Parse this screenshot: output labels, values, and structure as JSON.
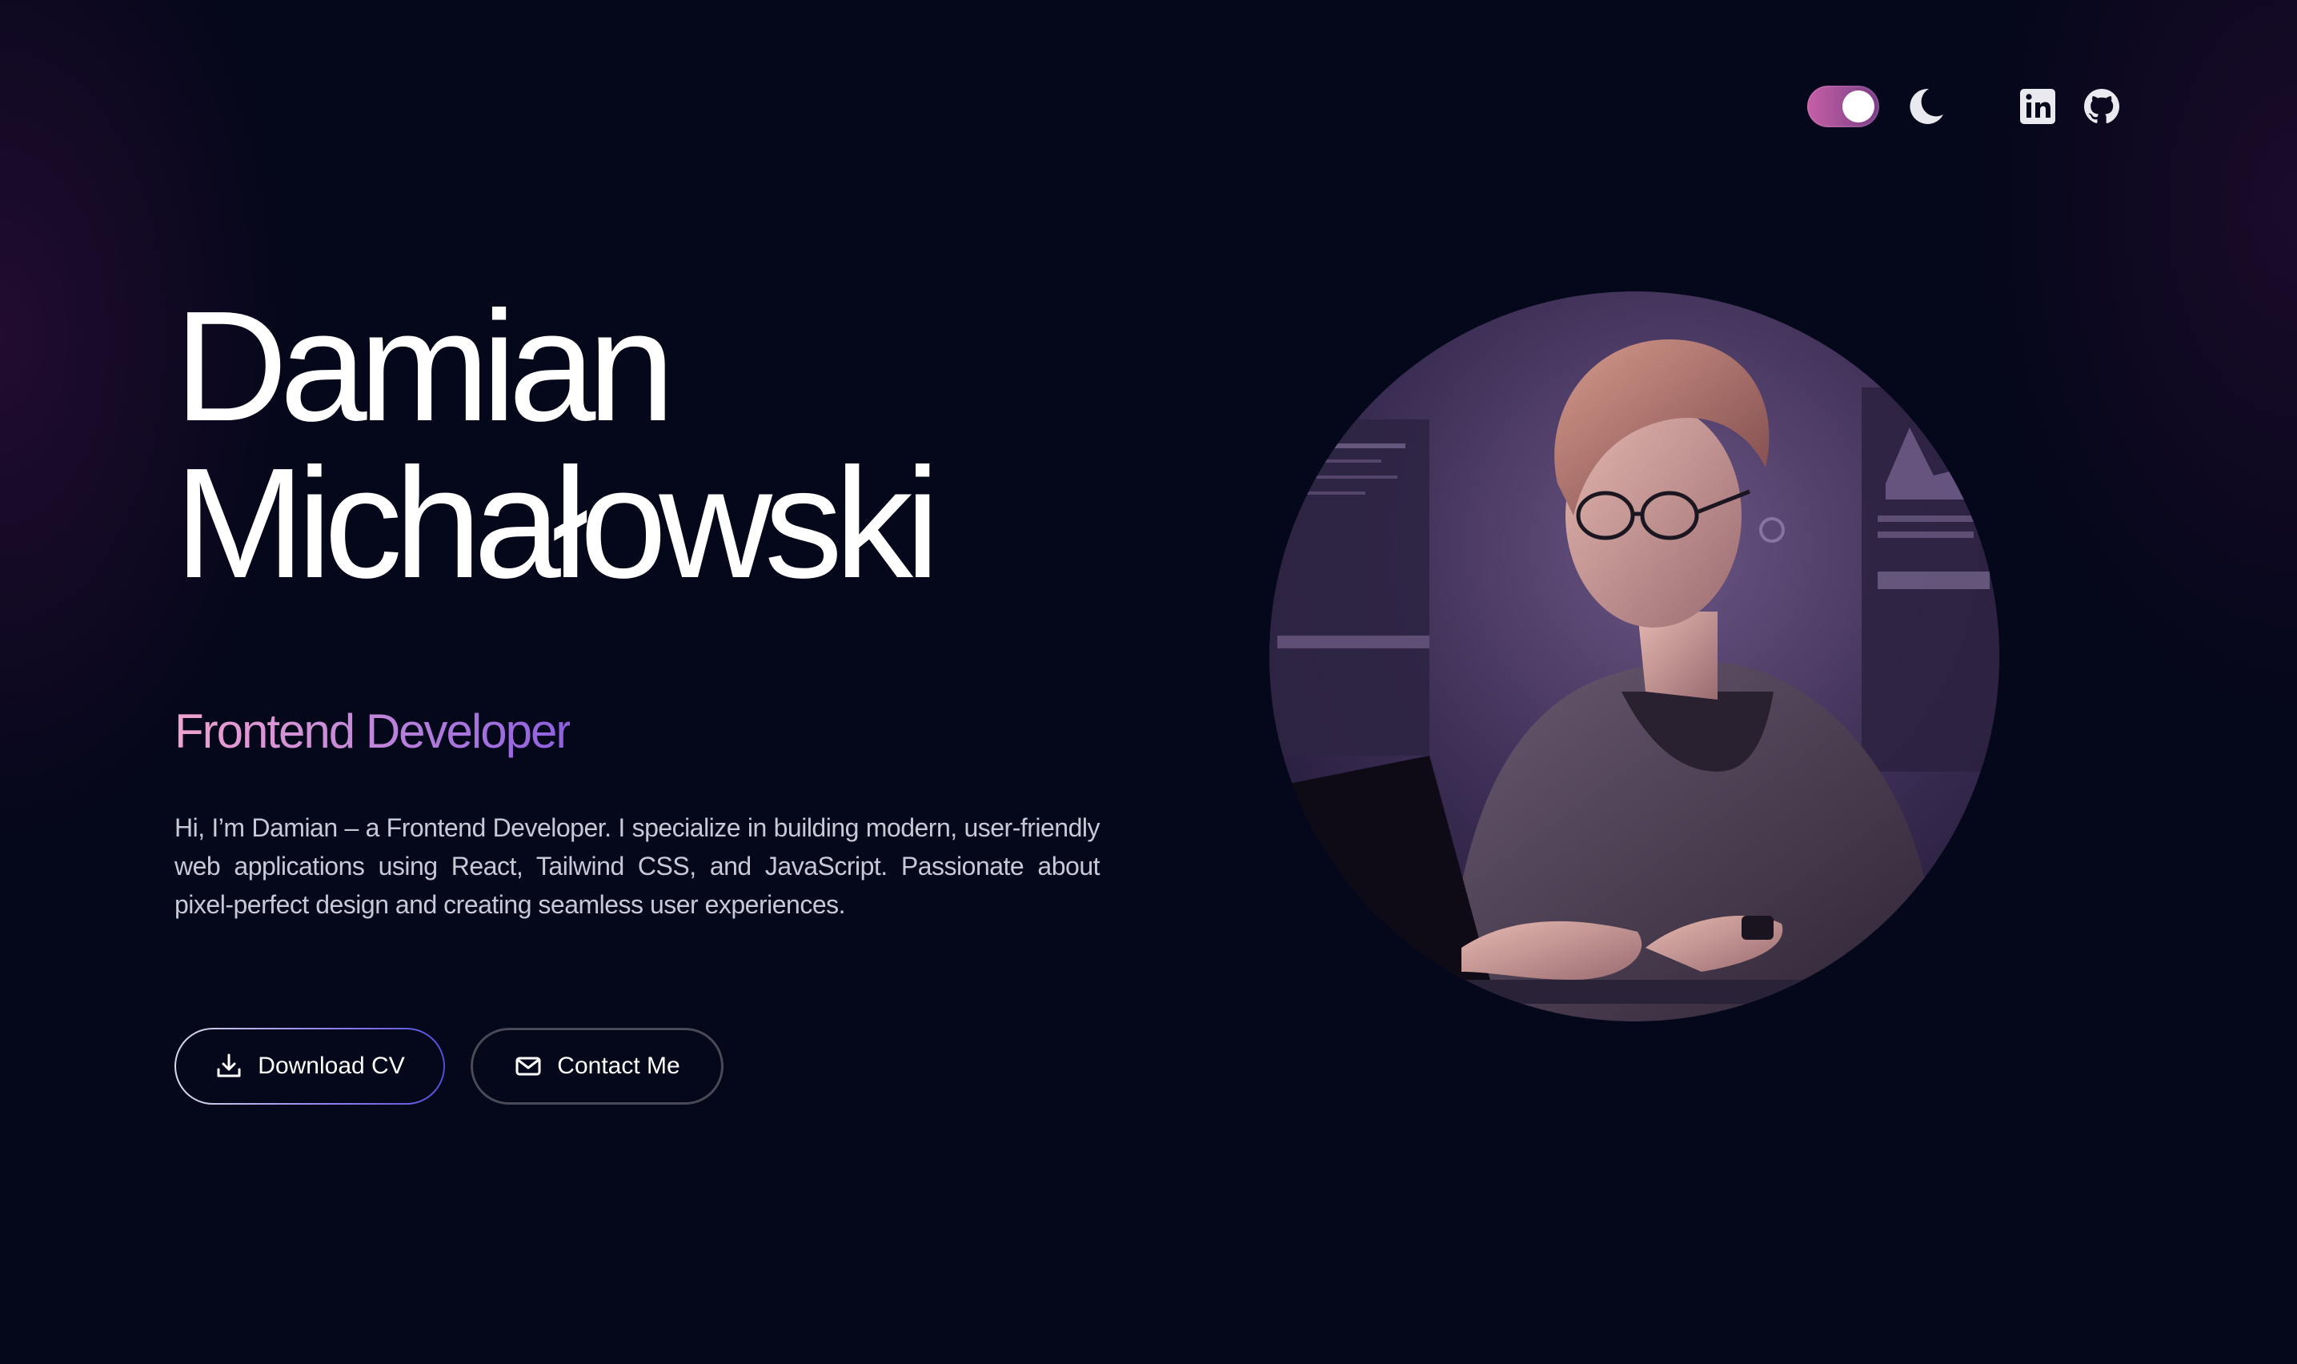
{
  "header": {
    "theme_toggle": {
      "state": "on",
      "icon": "moon-icon"
    },
    "social": [
      {
        "icon": "linkedin-icon",
        "label": "LinkedIn"
      },
      {
        "icon": "github-icon",
        "label": "GitHub"
      }
    ]
  },
  "hero": {
    "name_first": "Damian",
    "name_last": "Michałowski",
    "role": "Frontend Developer",
    "bio": "Hi, I’m Damian – a Frontend Developer. I specialize in building modern, user-friendly web applications using React, Tailwind CSS, and JavaScript. Passionate about pixel-perfect design and creating seamless user experiences.",
    "buttons": {
      "download_cv": "Download CV",
      "contact_me": "Contact Me"
    }
  },
  "colors": {
    "background": "#05071a",
    "accent_pink": "#f0a3cf",
    "accent_purple": "#8d5fe0",
    "toggle": "#c55fa6"
  }
}
